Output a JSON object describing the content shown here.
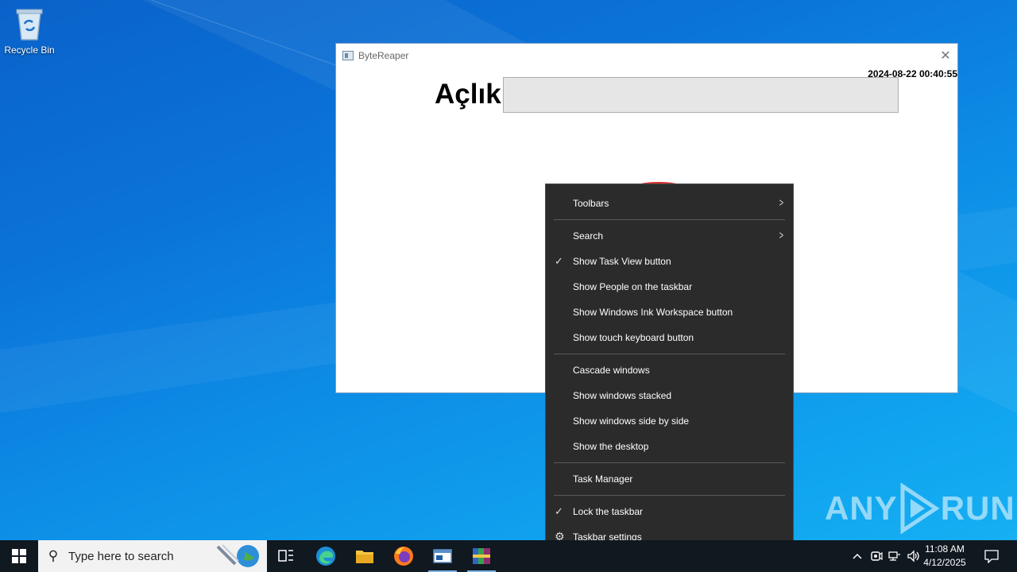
{
  "desktop": {
    "recycle_bin_label": "Recycle Bin"
  },
  "app_window": {
    "title": "ByteReaper",
    "close_glyph": "✕",
    "timestamp": "2024-08-22 00:40:55",
    "label": "Açlık",
    "input_value": ""
  },
  "context_menu": {
    "items": [
      {
        "label": "Toolbars",
        "submenu": true
      },
      {
        "label": "Search",
        "submenu": true
      },
      {
        "label": "Show Task View button",
        "checked": true
      },
      {
        "label": "Show People on the taskbar"
      },
      {
        "label": "Show Windows Ink Workspace button"
      },
      {
        "label": "Show touch keyboard button"
      },
      {
        "label": "Cascade windows"
      },
      {
        "label": "Show windows stacked"
      },
      {
        "label": "Show windows side by side"
      },
      {
        "label": "Show the desktop"
      },
      {
        "label": "Task Manager"
      },
      {
        "label": "Lock the taskbar",
        "checked": true
      },
      {
        "label": "Taskbar settings",
        "icon": "gear-icon"
      }
    ],
    "check_glyph": "✓",
    "arrow_glyph": ">",
    "gear_glyph": "⚙"
  },
  "watermark": {
    "left_text": "ANY",
    "right_text": "RUN"
  },
  "taskbar": {
    "search_placeholder": "Type here to search",
    "pinned": [
      "task-view-icon",
      "edge-icon",
      "file-explorer-icon",
      "firefox-icon",
      "bytereaper-app-icon",
      "winrar-icon"
    ],
    "clock_time": "11:08 AM",
    "clock_date": "4/12/2025",
    "tray_chevron": "^"
  },
  "colors": {
    "menu_bg": "#2b2b2b",
    "taskbar_bg": "#101820",
    "desktop_accent": "#0b74d9"
  }
}
